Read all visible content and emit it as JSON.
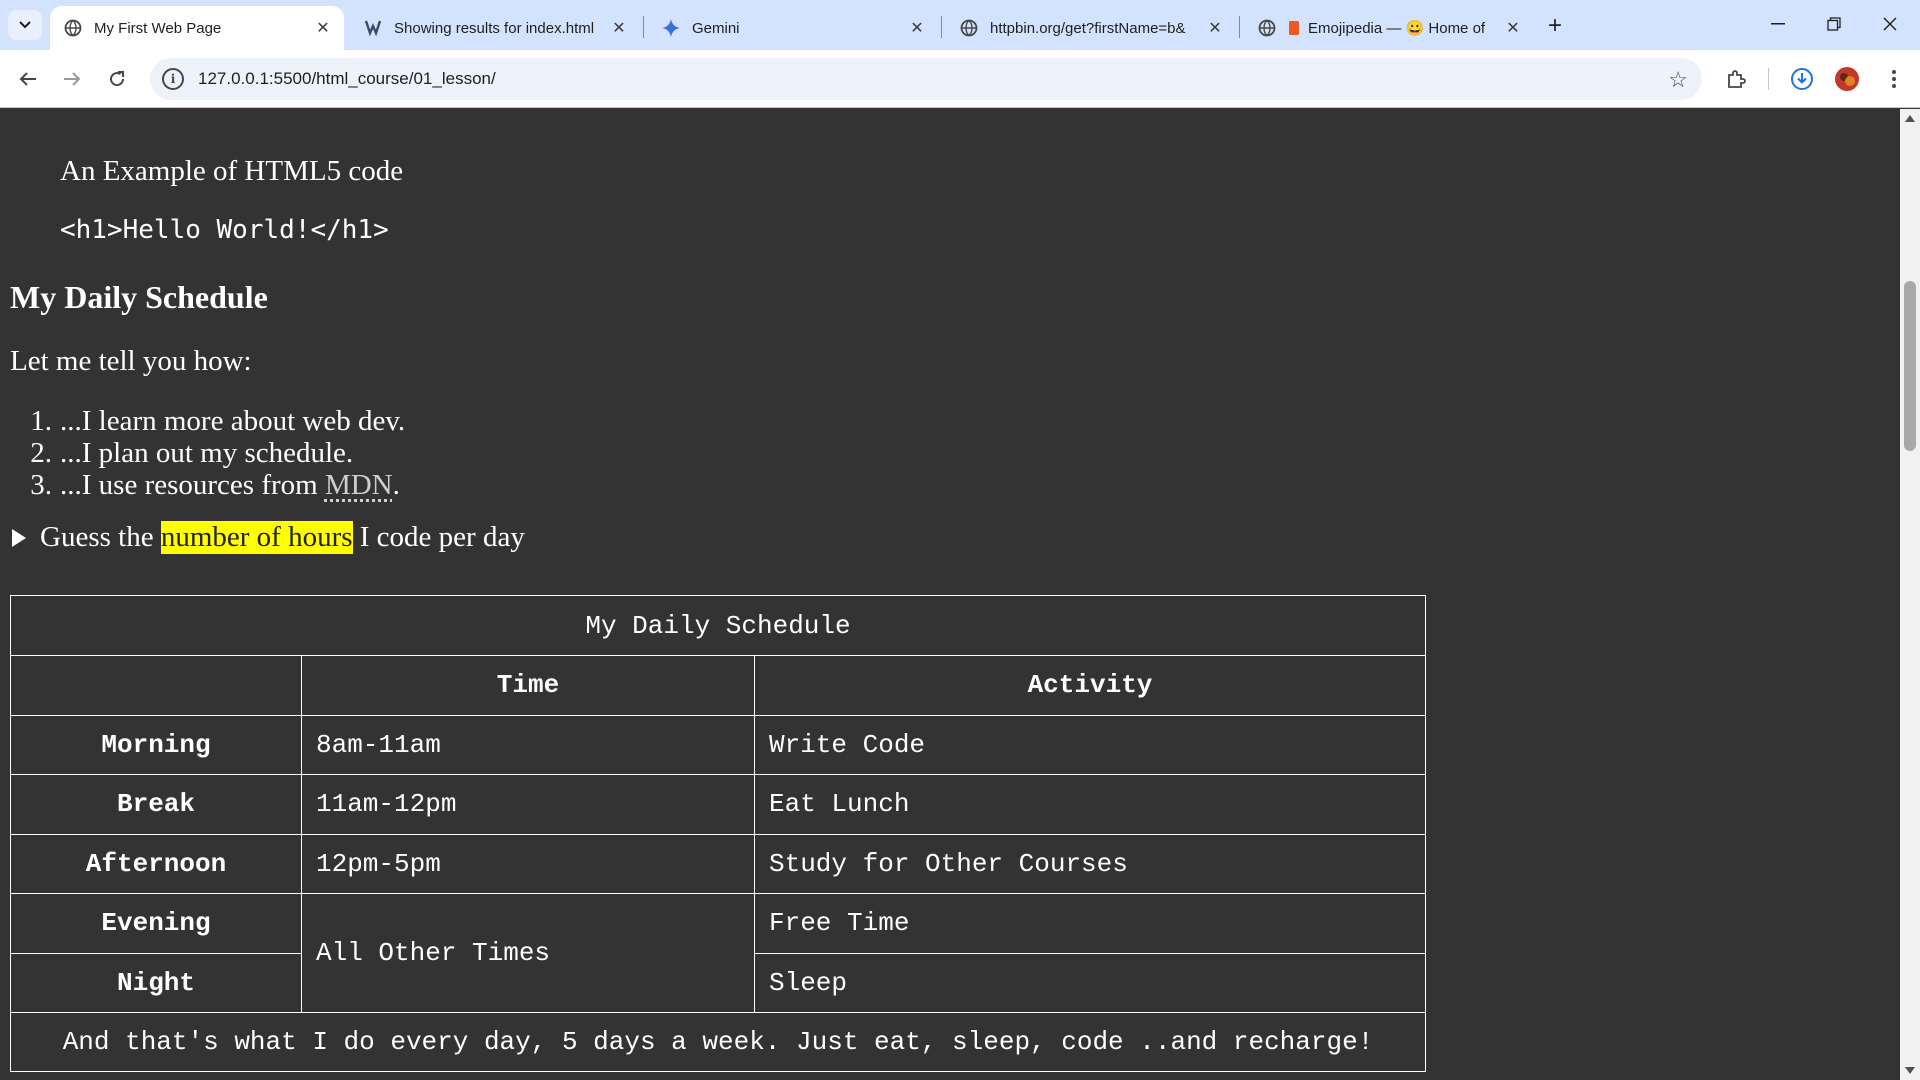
{
  "browser": {
    "tabs": [
      {
        "title": "My First Web Page",
        "active": true
      },
      {
        "title": "Showing results for index.html",
        "active": false
      },
      {
        "title": "Gemini",
        "active": false
      },
      {
        "title": "httpbin.org/get?firstName=b&",
        "active": false
      },
      {
        "title": "Emojipedia — 😀 Home of",
        "active": false
      }
    ],
    "url": "127.0.0.1:5500/html_course/01_lesson/"
  },
  "page": {
    "blockquote_text": "An Example of HTML5 code",
    "code_sample": "<h1>Hello World!</h1>",
    "heading": "My Daily Schedule",
    "intro": "Let me tell you how:",
    "list": [
      {
        "num": "1.",
        "text": "...I learn more about web dev."
      },
      {
        "num": "2.",
        "text": "...I plan out my schedule."
      },
      {
        "num": "3.",
        "text_before": "...I use resources from ",
        "link": "MDN",
        "text_after": "."
      }
    ],
    "summary": {
      "before": "Guess the ",
      "highlight": "number of hours",
      "after": " I code per day"
    },
    "table": {
      "caption": "My Daily Schedule",
      "headers": [
        "",
        "Time",
        "Activity"
      ],
      "rows": [
        {
          "label": "Morning",
          "time": "8am-11am",
          "activity": "Write Code"
        },
        {
          "label": "Break",
          "time": "11am-12pm",
          "activity": "Eat Lunch"
        },
        {
          "label": "Afternoon",
          "time": "12pm-5pm",
          "activity": "Study for Other Courses"
        },
        {
          "label": "Evening",
          "time": "All Other Times",
          "activity": "Free Time"
        },
        {
          "label": "Night",
          "activity": "Sleep"
        }
      ],
      "footer": "And that's what I do every day, 5 days a week. Just eat, sleep, code ..and recharge!"
    }
  },
  "colors": {
    "page_bg": "#333333",
    "highlight": "#ffff00",
    "tabstrip": "#d3e3fd"
  }
}
